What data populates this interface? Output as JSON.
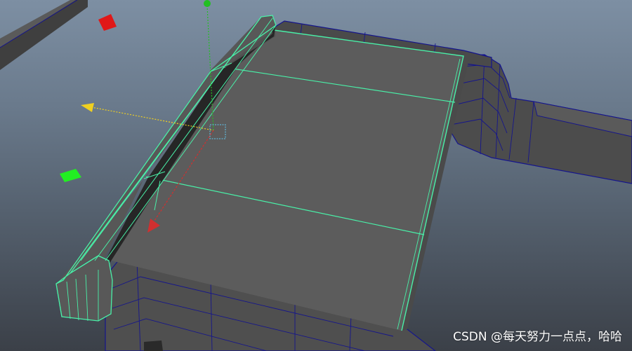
{
  "viewport": {
    "label": "3D modeling viewport",
    "colors": {
      "face": "#5c5c5c",
      "face_dark": "#3d3d3d",
      "selected_wire": "#49f0a8",
      "unselected_wire": "#15158c",
      "axis_x": "#d03030",
      "axis_y": "#22c022",
      "axis_z": "#f0d020"
    },
    "icons": [
      "move-manipulator-icon",
      "pivot-center-icon",
      "red-scale-handle-icon",
      "green-scale-handle-icon"
    ]
  },
  "watermark": {
    "text": "CSDN @每天努力一点点，哈哈"
  }
}
